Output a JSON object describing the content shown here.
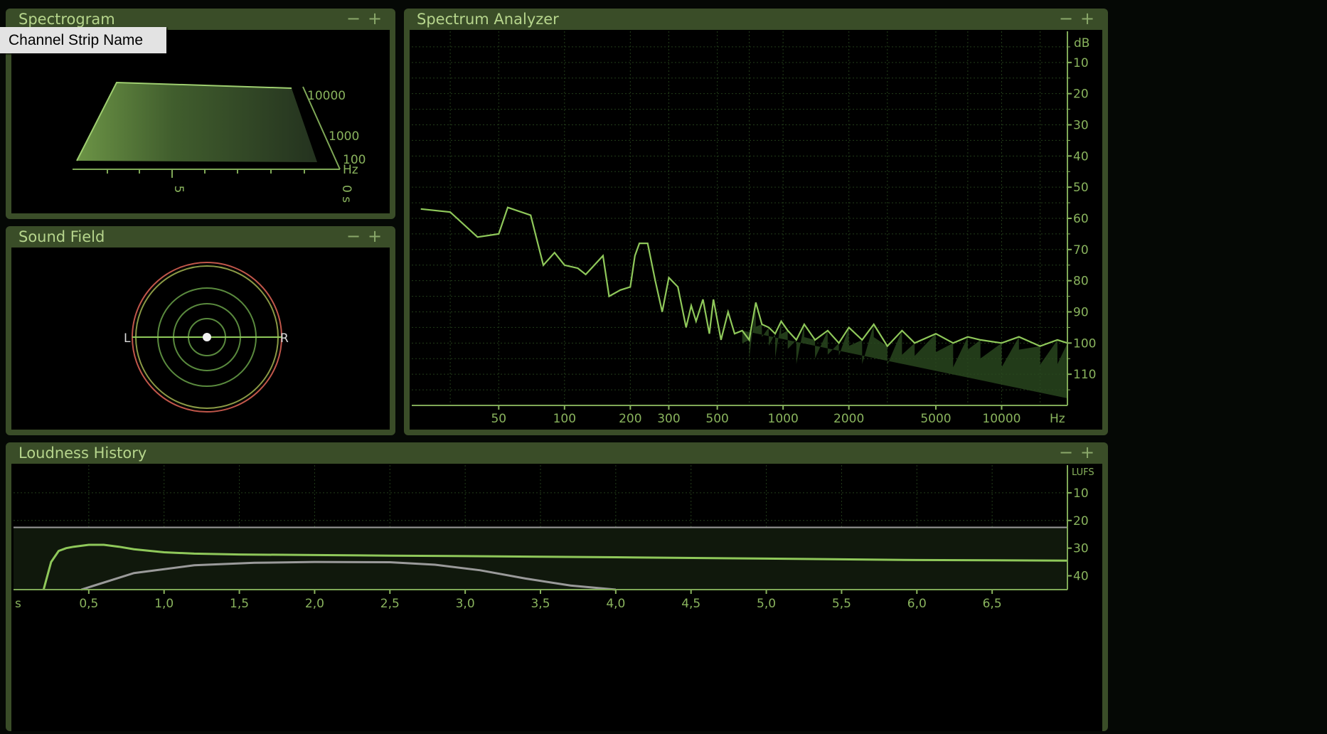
{
  "tooltip": "Channel Strip Name",
  "colors": {
    "trace": "#8fc85a",
    "frame": "#3a4d28",
    "title": "#b6d58c",
    "tick": "#89b35d",
    "grid": "#233d1a",
    "reference": "#9a9a9a",
    "ring_outer": "#c0564a"
  },
  "panels": {
    "spectrogram": {
      "title": "Spectrogram",
      "minimize_icon": "minus-icon",
      "maximize_icon": "plus-icon",
      "freq_labels": [
        "10000",
        "1000",
        "100",
        "Hz"
      ],
      "time_labels": [
        "5",
        "0 s"
      ]
    },
    "sound_field": {
      "title": "Sound Field",
      "left_label": "L",
      "right_label": "R"
    },
    "spectrum_analyzer": {
      "title": "Spectrum Analyzer",
      "db_unit": "dB",
      "db_labels": [
        "10",
        "20",
        "30",
        "40",
        "50",
        "60",
        "70",
        "80",
        "90",
        "100",
        "110"
      ],
      "hz_unit": "Hz",
      "hz_labels": [
        "50",
        "100",
        "200",
        "300",
        "500",
        "1000",
        "2000",
        "5000",
        "10000"
      ]
    },
    "loudness_history": {
      "title": "Loudness History",
      "lufs_unit": "LUFS",
      "lufs_labels": [
        "10",
        "20",
        "30",
        "40"
      ],
      "time_unit": "s",
      "time_labels": [
        "0,5",
        "1,0",
        "1,5",
        "2,0",
        "2,5",
        "3,0",
        "3,5",
        "4,0",
        "4,5",
        "5,0",
        "5,5",
        "6,0",
        "6,5"
      ]
    }
  },
  "chart_data": [
    {
      "type": "line",
      "x_scale": "log",
      "x": [
        22,
        30,
        40,
        50,
        55,
        70,
        80,
        90,
        100,
        115,
        125,
        150,
        160,
        180,
        200,
        210,
        220,
        240,
        260,
        280,
        300,
        330,
        360,
        380,
        400,
        430,
        460,
        480,
        520,
        560,
        600,
        650,
        700,
        750,
        800,
        860,
        920,
        980,
        1050,
        1150,
        1250,
        1400,
        1600,
        1800,
        2000,
        2300,
        2600,
        3000,
        3500,
        4000,
        5000,
        6000,
        7000,
        8000,
        10000,
        12000,
        15000,
        18000,
        20000
      ],
      "y": [
        57,
        58,
        66,
        65,
        56.5,
        59,
        75,
        71,
        75,
        76,
        78,
        72,
        85,
        83,
        82,
        72,
        68,
        68,
        80,
        90,
        79,
        82,
        95,
        88,
        93,
        86,
        97,
        86,
        99,
        90,
        97,
        96,
        99,
        87,
        94,
        95,
        97,
        93,
        96,
        99,
        94,
        99,
        96,
        100,
        95,
        99,
        94,
        101,
        96,
        100,
        97,
        100,
        98,
        99,
        100,
        98,
        101,
        99,
        100
      ],
      "ylim": [
        0,
        120
      ],
      "ylabel": "dB",
      "xlabel": "Hz"
    },
    {
      "type": "line",
      "x": [
        0.2,
        0.25,
        0.3,
        0.35,
        0.4,
        0.5,
        0.6,
        0.7,
        0.8,
        1.0,
        1.2,
        1.5,
        2.0,
        2.5,
        3.0,
        3.5,
        4.0,
        5.0,
        6.0,
        6.5,
        7.0
      ],
      "series": [
        {
          "values": [
            46,
            35,
            31,
            30,
            29.5,
            28.8,
            28.8,
            29.5,
            30.4,
            31.5,
            32,
            32.3,
            32.5,
            32.7,
            32.9,
            33.1,
            33.3,
            33.8,
            34.3,
            34.4,
            34.5
          ]
        }
      ],
      "reference_level": 22.5,
      "ylim": [
        0,
        45
      ],
      "xlim": [
        0,
        7
      ],
      "ylabel": "LUFS",
      "xlabel": "s"
    }
  ]
}
